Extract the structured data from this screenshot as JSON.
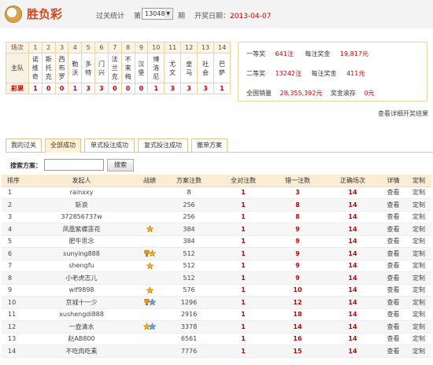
{
  "header": {
    "title": "胜负彩",
    "stat_label": "过关统计",
    "issue_prefix": "第",
    "issue_value": "13048",
    "issue_suffix": "期",
    "date_label": "开奖日期：",
    "date_value": "2013-04-07"
  },
  "matches": {
    "row_labels": [
      "场次",
      "主队",
      "彩果"
    ],
    "numbers": [
      "1",
      "2",
      "3",
      "4",
      "5",
      "6",
      "7",
      "8",
      "9",
      "10",
      "11",
      "12",
      "13",
      "14"
    ],
    "teams": [
      [
        "诺",
        "维",
        "奇"
      ],
      [
        "斯",
        "托",
        "克"
      ],
      [
        "西",
        "布",
        "罗"
      ],
      [
        "勒",
        "沃"
      ],
      [
        "多",
        "特"
      ],
      [
        "门",
        "兴"
      ],
      [
        "法",
        "兰",
        "克"
      ],
      [
        "不",
        "来",
        "梅"
      ],
      [
        "汉",
        "堡"
      ],
      [
        "博",
        "洛",
        "尼"
      ],
      [
        "尤",
        "文"
      ],
      [
        "皇",
        "马"
      ],
      [
        "社",
        "会"
      ],
      [
        "巴",
        "萨"
      ]
    ],
    "results": [
      "1",
      "0",
      "0",
      "1",
      "3",
      "3",
      "0",
      "0",
      "0",
      "1",
      "3",
      "3",
      "3",
      "1"
    ]
  },
  "prize": {
    "first_label": "一等奖",
    "first_count": "641注",
    "first_bonus_label": "每注奖金",
    "first_bonus": "19,817元",
    "second_label": "二等奖",
    "second_count": "13242注",
    "second_bonus_label": "每注奖金",
    "second_bonus": "411元",
    "sales_label": "全国销量",
    "sales": "28,355,392元",
    "pool_label": "奖金滚存",
    "pool": "0元",
    "detail_link": "查看详细开奖结果"
  },
  "tabs": [
    "我的过关",
    "全部成功",
    "单式投注成功",
    "复式投注成功",
    "撤单方案"
  ],
  "search": {
    "label": "搜索方案：",
    "placeholder": "",
    "button": "搜索"
  },
  "ranking": {
    "columns": [
      "排序",
      "发起人",
      "战绩",
      "方案注数",
      "全对注数",
      "错一注数",
      "正确场次",
      "详情",
      "定制"
    ],
    "rows": [
      {
        "rank": "1",
        "user": "rainxxy",
        "medals": [],
        "bets": "8",
        "all": "1",
        "one": "3",
        "correct": "14",
        "detail": "查看",
        "custom": "定制"
      },
      {
        "rank": "2",
        "user": "斩浪",
        "medals": [],
        "bets": "256",
        "all": "1",
        "one": "8",
        "correct": "14",
        "detail": "查看",
        "custom": "定制"
      },
      {
        "rank": "3",
        "user": "372856737w",
        "medals": [],
        "bets": "256",
        "all": "1",
        "one": "8",
        "correct": "14",
        "detail": "查看",
        "custom": "定制"
      },
      {
        "rank": "4",
        "user": "凤凰紫蝶莲花",
        "medals": [
          "gold"
        ],
        "bets": "384",
        "all": "1",
        "one": "9",
        "correct": "14",
        "detail": "查看",
        "custom": "定制"
      },
      {
        "rank": "5",
        "user": "肥牛思念",
        "medals": [],
        "bets": "384",
        "all": "1",
        "one": "9",
        "correct": "14",
        "detail": "查看",
        "custom": "定制"
      },
      {
        "rank": "6",
        "user": "sunying888",
        "medals": [
          "cup",
          "gold"
        ],
        "bets": "512",
        "all": "1",
        "one": "9",
        "correct": "14",
        "detail": "查看",
        "custom": "定制"
      },
      {
        "rank": "7",
        "user": "shengfu",
        "medals": [
          "gold"
        ],
        "bets": "512",
        "all": "1",
        "one": "9",
        "correct": "14",
        "detail": "查看",
        "custom": "定制"
      },
      {
        "rank": "8",
        "user": "小老虎志儿",
        "medals": [],
        "bets": "512",
        "all": "1",
        "one": "9",
        "correct": "14",
        "detail": "查看",
        "custom": "定制"
      },
      {
        "rank": "9",
        "user": "wlf9898",
        "medals": [
          "gold"
        ],
        "bets": "576",
        "all": "1",
        "one": "10",
        "correct": "14",
        "detail": "查看",
        "custom": "定制"
      },
      {
        "rank": "10",
        "user": "京城十一少",
        "medals": [
          "cup",
          "blue"
        ],
        "bets": "1296",
        "all": "1",
        "one": "12",
        "correct": "14",
        "detail": "查看",
        "custom": "定制"
      },
      {
        "rank": "11",
        "user": "xushengdi888",
        "medals": [],
        "bets": "2916",
        "all": "1",
        "one": "18",
        "correct": "14",
        "detail": "查看",
        "custom": "定制"
      },
      {
        "rank": "12",
        "user": "一壶清水",
        "medals": [
          "gold",
          "blue"
        ],
        "bets": "3378",
        "all": "1",
        "one": "14",
        "correct": "14",
        "detail": "查看",
        "custom": "定制"
      },
      {
        "rank": "13",
        "user": "赵AB800",
        "medals": [],
        "bets": "6561",
        "all": "1",
        "one": "16",
        "correct": "14",
        "detail": "查看",
        "custom": "定制"
      },
      {
        "rank": "14",
        "user": "不吃肉吃素",
        "medals": [],
        "bets": "7776",
        "all": "1",
        "one": "15",
        "correct": "14",
        "detail": "查看",
        "custom": "定制"
      }
    ]
  },
  "colors": {
    "accent": "#d8431a",
    "result_red": "#cc0000",
    "border_gold": "#f0d29c",
    "tab_active": "#fdf0d3"
  }
}
